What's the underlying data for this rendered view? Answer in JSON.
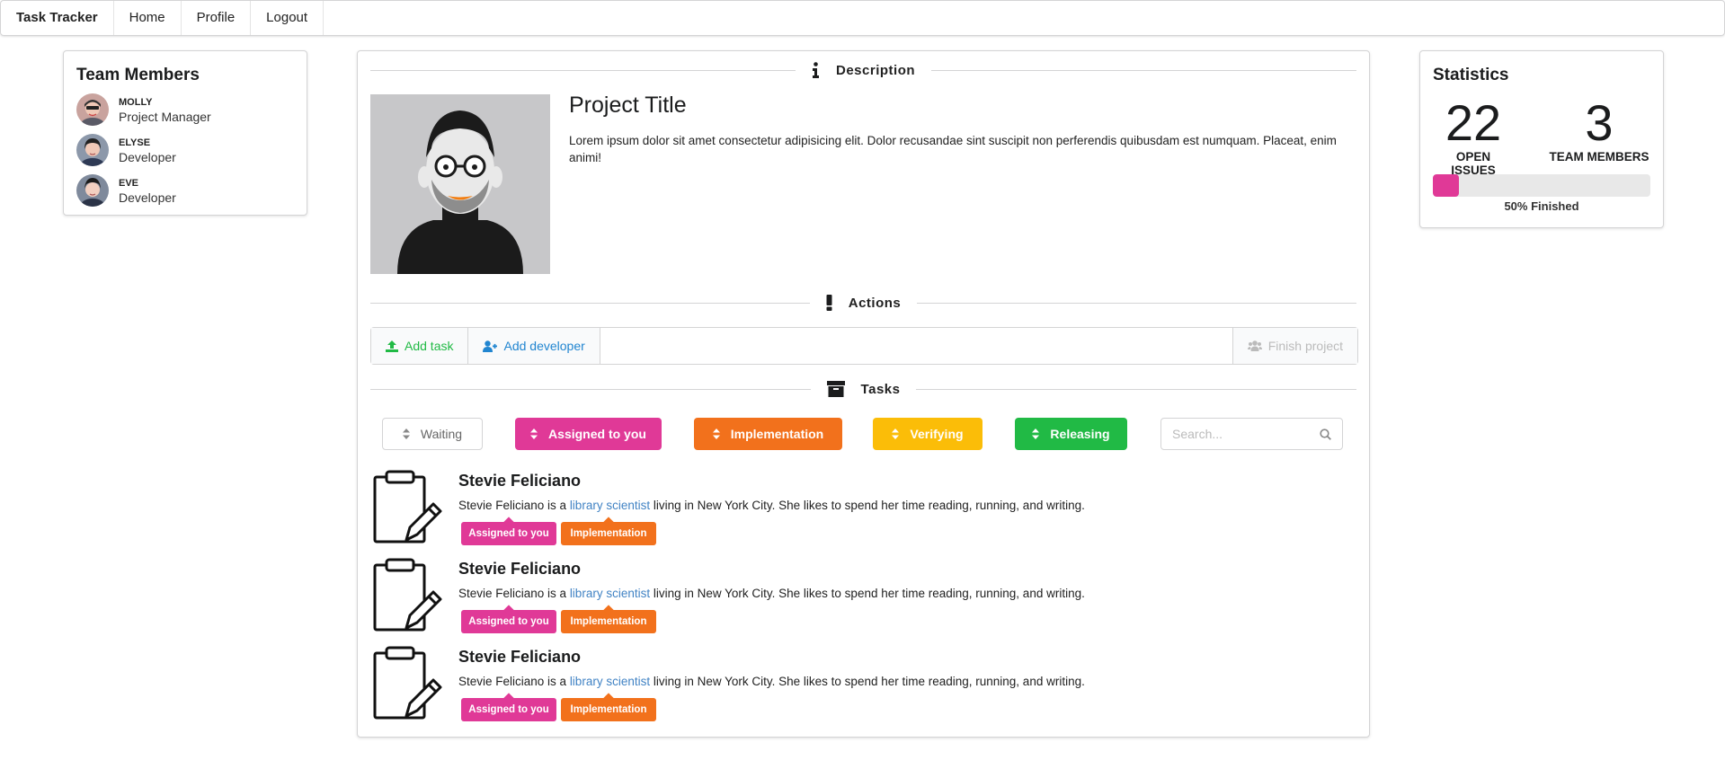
{
  "nav": {
    "brand": "Task Tracker",
    "items": [
      "Home",
      "Profile",
      "Logout"
    ]
  },
  "team": {
    "title": "Team Members",
    "members": [
      {
        "name": "MOLLY",
        "role": "Project Manager"
      },
      {
        "name": "ELYSE",
        "role": "Developer"
      },
      {
        "name": "EVE",
        "role": "Developer"
      }
    ]
  },
  "description": {
    "label": "Description",
    "icon": "info-icon",
    "project_title": "Project Title",
    "text": "Lorem ipsum dolor sit amet consectetur adipisicing elit. Dolor recusandae sint suscipit non perferendis quibusdam est numquam. Placeat, enim animi!"
  },
  "actions": {
    "label": "Actions",
    "icon": "exclamation-icon",
    "add_task": "Add task",
    "add_developer": "Add developer",
    "finish_project": "Finish project"
  },
  "tasks": {
    "label": "Tasks",
    "icon": "archive-icon",
    "filters": [
      {
        "label": "Waiting",
        "color": "#ffffff"
      },
      {
        "label": "Assigned to you",
        "color": "#e03997"
      },
      {
        "label": "Implementation",
        "color": "#f2711c"
      },
      {
        "label": "Verifying",
        "color": "#fbbd08"
      },
      {
        "label": "Releasing",
        "color": "#21ba45"
      }
    ],
    "search_placeholder": "Search...",
    "items": [
      {
        "name": "Stevie Feliciano",
        "desc_pre": "Stevie Feliciano is a ",
        "desc_link": "library scientist",
        "desc_post": " living in New York City. She likes to spend her time reading, running, and writing.",
        "tags": [
          "Assigned to you",
          "Implementation"
        ]
      },
      {
        "name": "Stevie Feliciano",
        "desc_pre": "Stevie Feliciano is a ",
        "desc_link": "library scientist",
        "desc_post": " living in New York City. She likes to spend her time reading, running, and writing.",
        "tags": [
          "Assigned to you",
          "Implementation"
        ]
      },
      {
        "name": "Stevie Feliciano",
        "desc_pre": "Stevie Feliciano is a ",
        "desc_link": "library scientist",
        "desc_post": " living in New York City. She likes to spend her time reading, running, and writing.",
        "tags": [
          "Assigned to you",
          "Implementation"
        ]
      }
    ]
  },
  "stats": {
    "title": "Statistics",
    "open_issues": "22",
    "open_issues_label": "OPEN ISSUES",
    "team_members": "3",
    "team_members_label": "TEAM MEMBERS",
    "progress": 0.12,
    "progress_label": "50% Finished"
  },
  "colors": {
    "pink": "#e03997",
    "orange": "#f2711c",
    "yellow": "#fbbd08",
    "green": "#21ba45",
    "blue": "#2185d0",
    "link": "#4183c4"
  }
}
